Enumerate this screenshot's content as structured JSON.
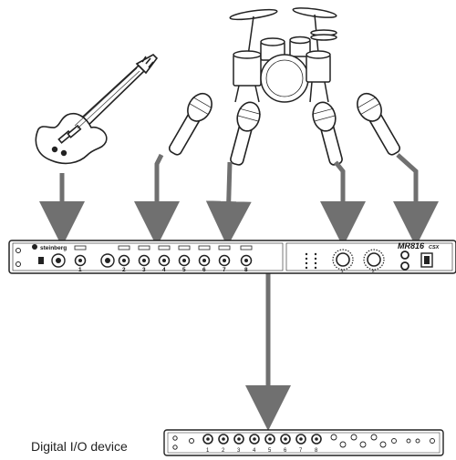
{
  "interface": {
    "brand": "steinberg",
    "model": "MR816",
    "model_suffix": "CSX",
    "channel_numbers": [
      "1",
      "2",
      "3",
      "4",
      "5",
      "6",
      "7",
      "8"
    ],
    "knob_numbers": [
      "1",
      "2"
    ]
  },
  "digital_io": {
    "label": "Digital I/O device",
    "channel_numbers": [
      "1",
      "2",
      "3",
      "4",
      "5",
      "6",
      "7",
      "8"
    ]
  },
  "colors": {
    "arrow": "#707070",
    "line": "#222222",
    "panel": "#ffffff"
  },
  "sources": [
    {
      "name": "guitar-icon"
    },
    {
      "name": "drum-kit-icon"
    },
    {
      "name": "microphone-icon"
    }
  ]
}
